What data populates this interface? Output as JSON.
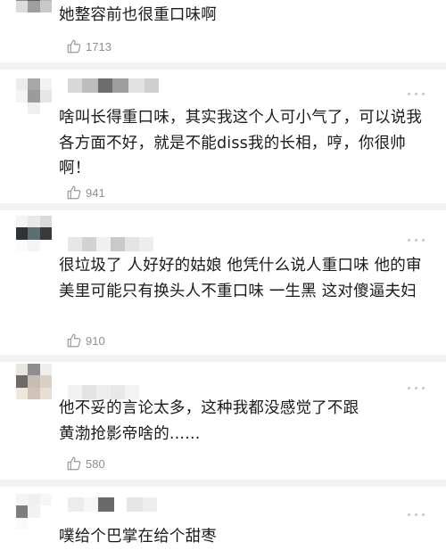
{
  "comments": [
    {
      "text": "她整容前也很重口味啊",
      "likes": "1713"
    },
    {
      "text": "啥叫长得重口味，其实我这个人可小气了，可以说我各方面不好，就是不能diss我的长相，哼，你很帅啊！",
      "likes": "941"
    },
    {
      "text": "很垃圾了 人好好的姑娘 他凭什么说人重口味 他的审美里可能只有换头人不重口味 一生黑 这对傻逼夫妇",
      "likes": "910"
    },
    {
      "text": "他不妥的言论太多，这种我都没感觉了不跟黄渤抢影帝啥的......",
      "likes": "580"
    },
    {
      "text": "噗给个巴掌在给个甜枣",
      "likes": ""
    }
  ],
  "colors": {
    "divider": "#f2f2f2",
    "text": "#1a1a1a",
    "meta": "#8f8f8f",
    "icon": "#c4c4c4"
  },
  "icons": {
    "like": "thumbs-up-icon",
    "more": "more-dots-icon"
  }
}
